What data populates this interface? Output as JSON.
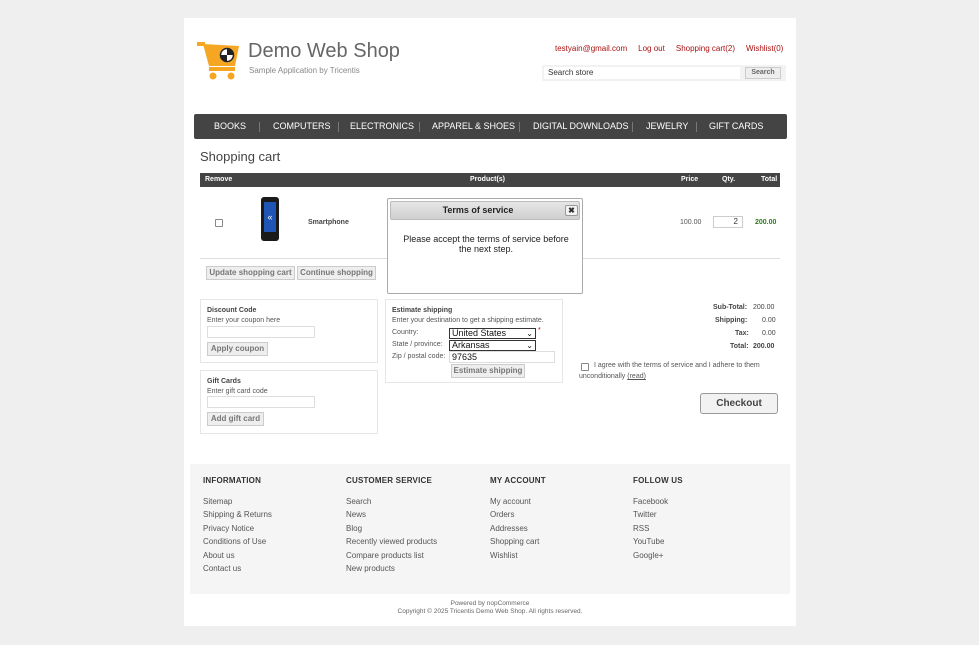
{
  "header": {
    "logo_title": "Demo Web Shop",
    "logo_subtitle": "Sample Application by Tricentis",
    "links": [
      "testyain@gmail.com",
      "Log out",
      "Shopping cart(2)",
      "Wishlist(0)"
    ],
    "search_value": "Search store",
    "search_button": "Search",
    "accent_color": "#aa1111"
  },
  "nav": {
    "items": [
      "BOOKS",
      "COMPUTERS",
      "ELECTRONICS",
      "APPAREL & SHOES",
      "DIGITAL DOWNLOADS",
      "JEWELRY",
      "GIFT CARDS"
    ]
  },
  "cart": {
    "page_title": "Shopping cart",
    "columns": {
      "remove": "Remove",
      "product": "Product(s)",
      "price": "Price",
      "qty": "Qty.",
      "total": "Total"
    },
    "row": {
      "product": "Smartphone",
      "price": "100.00",
      "qty": "2",
      "total": "200.00",
      "image_icon": "smartphone-icon"
    },
    "update_button": "Update shopping cart",
    "continue_button": "Continue shopping"
  },
  "discount": {
    "title": "Discount Code",
    "hint": "Enter your coupon here",
    "button": "Apply coupon"
  },
  "gift": {
    "title": "Gift Cards",
    "hint": "Enter gift card code",
    "button": "Add gift card"
  },
  "shipping": {
    "title": "Estimate shipping",
    "hint": "Enter your destination to get a shipping estimate.",
    "country_label": "Country:",
    "country_value": "United States",
    "required_mark": "*",
    "state_label": "State / province:",
    "state_value": "Arkansas",
    "zip_label": "Zip / postal code:",
    "zip_value": "97635",
    "button": "Estimate shipping"
  },
  "totals": {
    "subtotal_label": "Sub-Total:",
    "subtotal_value": "200.00",
    "shipping_label": "Shipping:",
    "shipping_value": "0.00",
    "tax_label": "Tax:",
    "tax_value": "0.00",
    "total_label": "Total:",
    "total_value": "200.00"
  },
  "terms": {
    "text_line1": "I agree with the terms of service and I adhere to them",
    "text_line2": "unconditionally",
    "read_link": "(read)"
  },
  "checkout_button": "Checkout",
  "modal": {
    "title": "Terms of service",
    "close_icon": "close-icon",
    "message": "Please accept the terms of service before the next step."
  },
  "footer": {
    "columns": [
      {
        "title": "INFORMATION",
        "links": [
          "Sitemap",
          "Shipping & Returns",
          "Privacy Notice",
          "Conditions of Use",
          "About us",
          "Contact us"
        ]
      },
      {
        "title": "CUSTOMER SERVICE",
        "links": [
          "Search",
          "News",
          "Blog",
          "Recently viewed products",
          "Compare products list",
          "New products"
        ]
      },
      {
        "title": "MY ACCOUNT",
        "links": [
          "My account",
          "Orders",
          "Addresses",
          "Shopping cart",
          "Wishlist"
        ]
      },
      {
        "title": "FOLLOW US",
        "links": [
          "Facebook",
          "Twitter",
          "RSS",
          "YouTube",
          "Google+"
        ]
      }
    ],
    "powered": "Powered by nopCommerce",
    "copyright": "Copyright © 2025 Tricentis Demo Web Shop. All rights reserved."
  }
}
